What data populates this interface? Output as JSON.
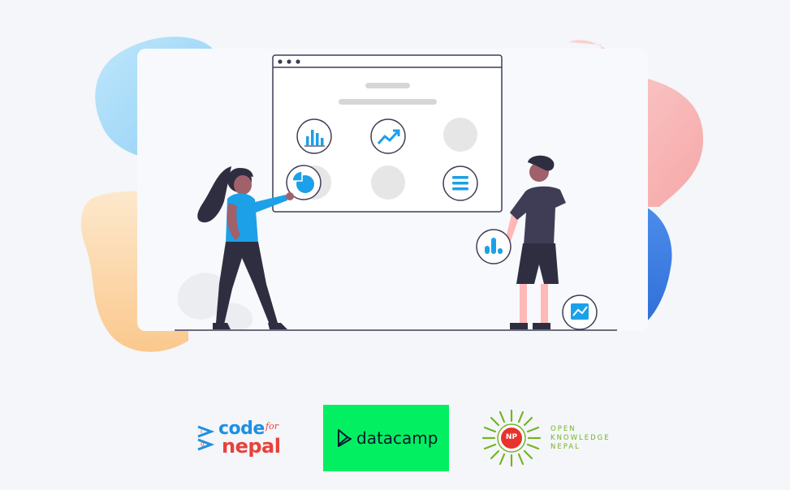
{
  "illustration": {
    "colors": {
      "background": "#f4f6f9",
      "blob_blue": "#a9dcf8",
      "blob_pink": "#f7b4b4",
      "blob_orange": "#fcd9b0",
      "blob_dark_blue": "#3d7fe0",
      "accent": "#1ca0e8",
      "dark": "#2f2e41"
    },
    "browser_icons": [
      "bar-chart-icon",
      "trend-up-icon",
      "placeholder-circle",
      "pie-chart-icon",
      "placeholder-circle",
      "menu-lines-icon"
    ],
    "floating_icons": [
      "bar-bubble-icon",
      "line-chart-icon"
    ]
  },
  "logos": {
    "code_for_nepal": {
      "code": "code",
      "for": "for",
      "nepal": "nepal",
      "prefix": "i>"
    },
    "datacamp": {
      "text": "datacamp",
      "bg_color": "#03ef62"
    },
    "open_knowledge_nepal": {
      "badge": "NP",
      "line1": "OPEN",
      "line2": "KNOWLEDGE",
      "line3": "NEPAL",
      "color": "#74b424"
    }
  }
}
